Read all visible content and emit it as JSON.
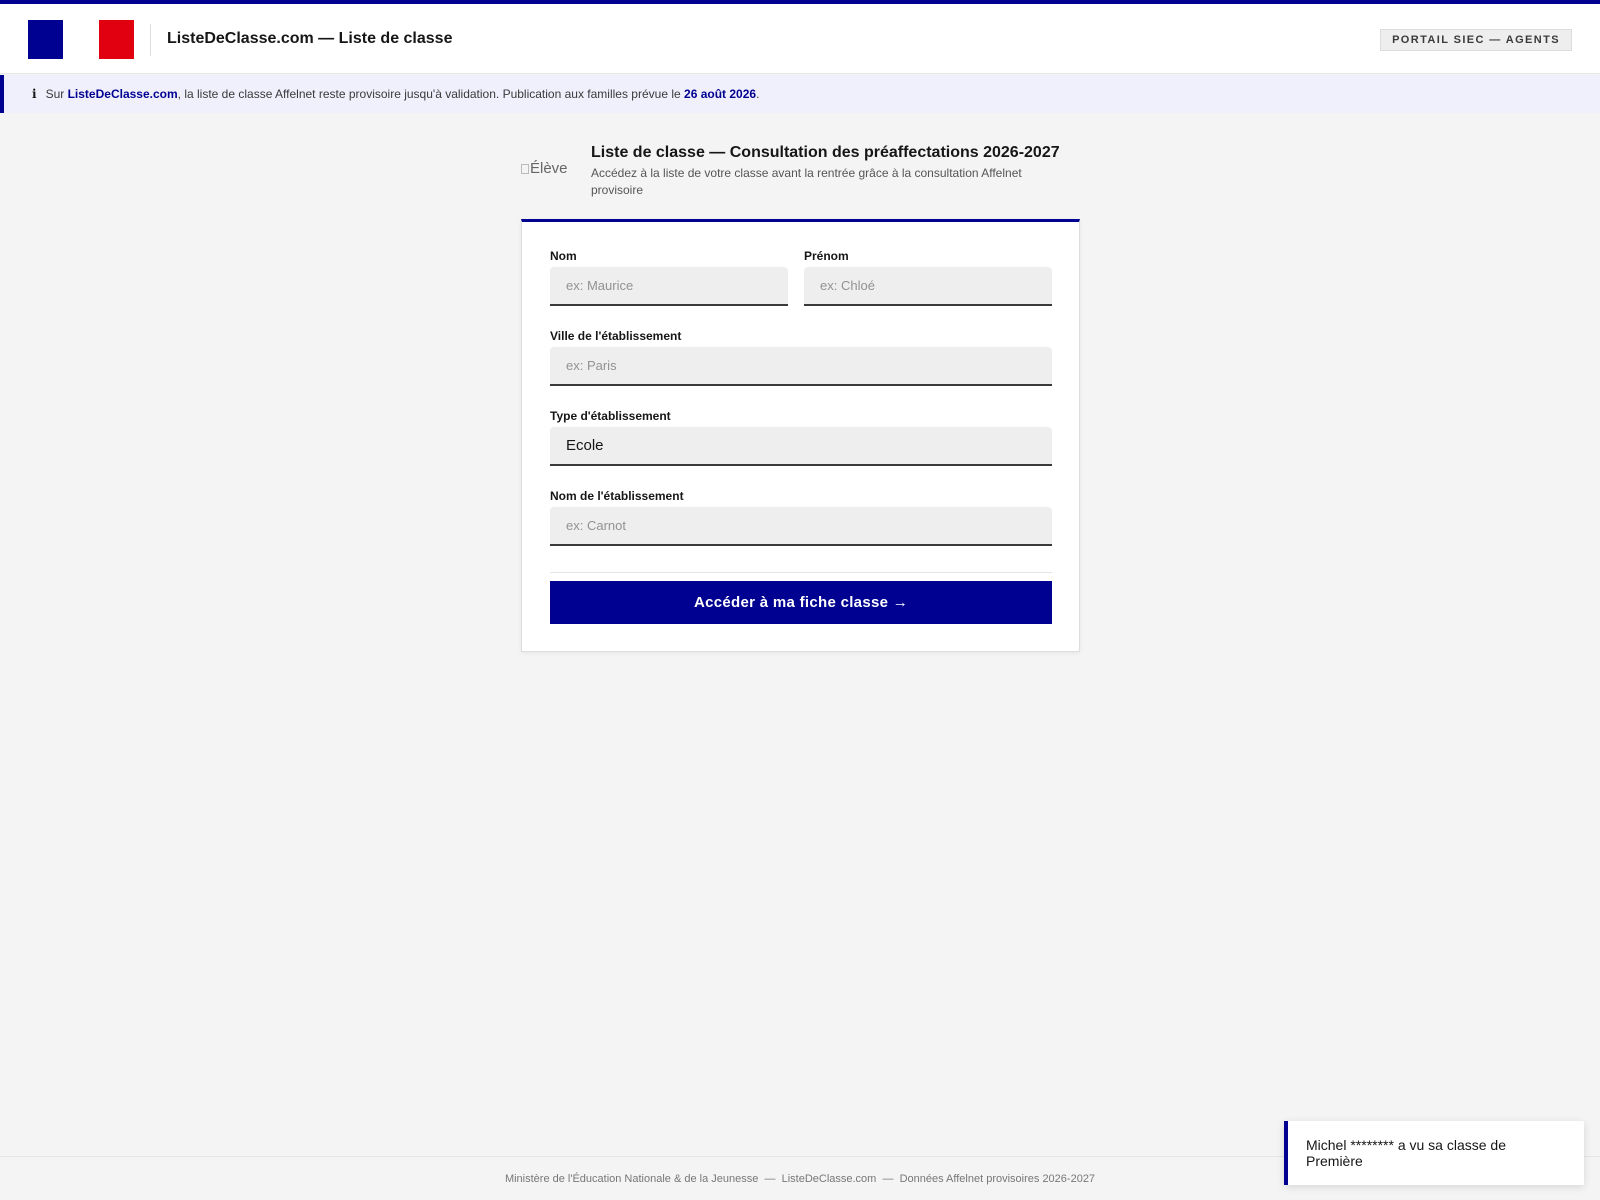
{
  "header": {
    "site_title": "ListeDeClasse.com — Liste de classe",
    "portal_badge": "PORTAIL SIEC — AGENTS",
    "flag_colors": [
      "#000091",
      "#ffffff",
      "#e1000f"
    ]
  },
  "notice": {
    "icon": "info-icon",
    "icon_glyph": "i",
    "prefix": "Sur",
    "site": "ListeDeClasse.com",
    "middle": ", la liste de classe Affelnet reste provisoire jusqu'à validation. Publication aux familles prévue le",
    "date": "26 août 2026",
    "suffix": "."
  },
  "hero": {
    "image_alt": "Élève",
    "title": "Liste de classe — Consultation des préaffectations 2026-2027",
    "subtitle": "Accédez à la liste de votre classe avant la rentrée grâce à la consultation Affelnet provisoire"
  },
  "form": {
    "nom": {
      "label": "Nom",
      "placeholder": "ex: Maurice",
      "value": ""
    },
    "prenom": {
      "label": "Prénom",
      "placeholder": "ex: Chloé",
      "value": ""
    },
    "ville": {
      "label": "Ville de l'établissement",
      "placeholder": "ex: Paris",
      "value": ""
    },
    "type": {
      "label": "Type d'établissement",
      "selected": "Ecole"
    },
    "etablissement": {
      "label": "Nom de l'établissement",
      "placeholder": "ex: Carnot",
      "value": ""
    },
    "submit_label": "Accéder à ma fiche classe →"
  },
  "footer": {
    "text": "Ministère de l'Éducation Nationale & de la Jeunesse  —  ListeDeClasse.com  —  Données Affelnet provisoires 2026-2027"
  },
  "toast": {
    "message": "Michel ******** a vu sa classe de Première"
  },
  "colors": {
    "accent": "#000091",
    "red": "#e1000f",
    "background": "#f4f4f4"
  }
}
